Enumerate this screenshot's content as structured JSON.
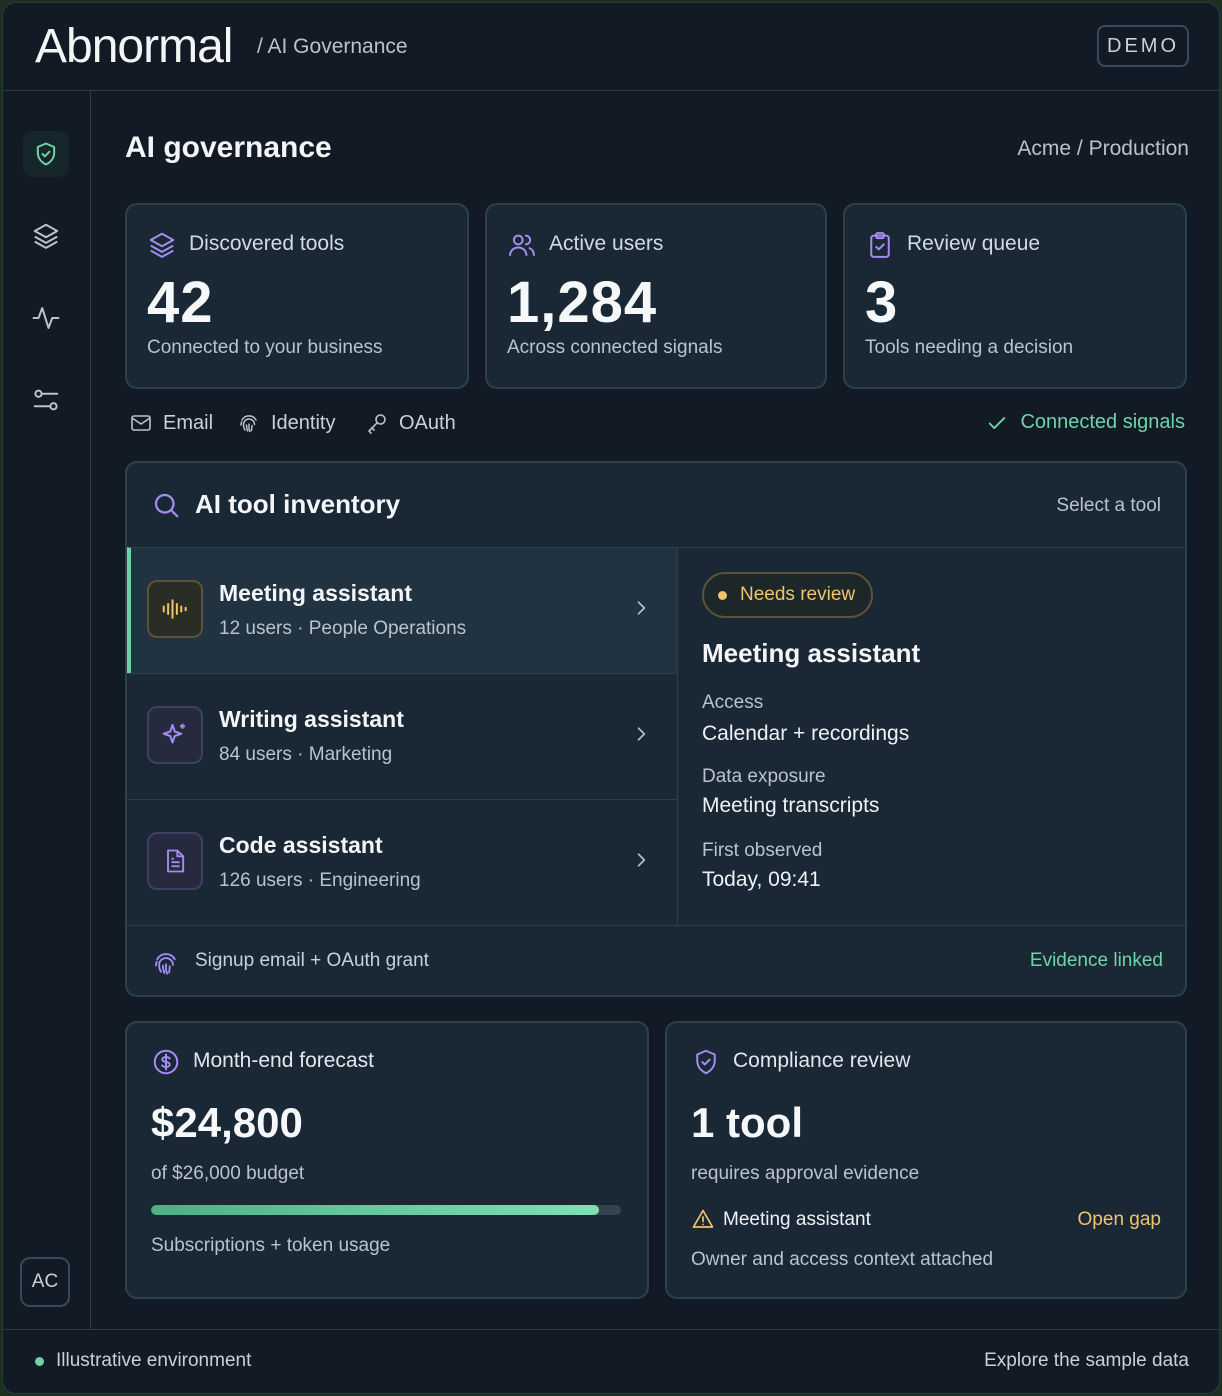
{
  "header": {
    "logo_text": "Abnormal",
    "breadcrumb": "/ AI Governance",
    "mode_badge": "DEMO"
  },
  "sidebar": {
    "items": [
      {
        "icon": "shield-check-icon",
        "active": true
      },
      {
        "icon": "layers-icon",
        "active": false
      },
      {
        "icon": "activity-icon",
        "active": false
      },
      {
        "icon": "sliders-icon",
        "active": false
      }
    ],
    "avatar_initials": "AC"
  },
  "page": {
    "title": "AI governance",
    "environment": "Acme / Production"
  },
  "stats": [
    {
      "icon": "layers-icon",
      "label": "Discovered tools",
      "value": "42",
      "description": "Connected to your business"
    },
    {
      "icon": "users-icon",
      "label": "Active users",
      "value": "1,284",
      "description": "Across connected signals"
    },
    {
      "icon": "clipboard-check-icon",
      "label": "Review queue",
      "value": "3",
      "description": "Tools needing a decision"
    }
  ],
  "signals": {
    "items": [
      "Email",
      "Identity",
      "OAuth"
    ],
    "status": "Connected signals"
  },
  "inventory": {
    "title": "AI tool inventory",
    "action": "Select a tool",
    "tools": [
      {
        "name": "Meeting assistant",
        "meta": "12 users · People Operations",
        "icon": "waveform-icon",
        "selected": true
      },
      {
        "name": "Writing assistant",
        "meta": "84 users · Marketing",
        "icon": "sparkle-icon",
        "selected": false
      },
      {
        "name": "Code assistant",
        "meta": "126 users · Engineering",
        "icon": "document-icon",
        "selected": false
      }
    ],
    "detail": {
      "status": "Needs review",
      "title": "Meeting assistant",
      "access_label": "Access",
      "access_value": "Calendar + recordings",
      "exposure_label": "Data exposure",
      "exposure_value": "Meeting transcripts",
      "observed_label": "First observed",
      "observed_value": "Today, 09:41"
    },
    "footer": {
      "evidence": "Signup email + OAuth grant",
      "status": "Evidence linked"
    }
  },
  "forecast": {
    "title": "Month-end forecast",
    "amount": "$24,800",
    "budget": "of $26,000 budget",
    "progress": 0.954,
    "note": "Subscriptions + token usage"
  },
  "compliance": {
    "title": "Compliance review",
    "count": "1 tool",
    "description": "requires approval evidence",
    "tool": "Meeting assistant",
    "gap": "Open gap",
    "note": "Owner and access context attached"
  },
  "status_bar": {
    "left": "Illustrative environment",
    "right": "Explore the sample data"
  },
  "colors": {
    "accent_green": "#6fd3a8",
    "accent_purple": "#a58cf0",
    "warning": "#f0c36d",
    "background": "#121b25",
    "card": "#1a2835"
  }
}
